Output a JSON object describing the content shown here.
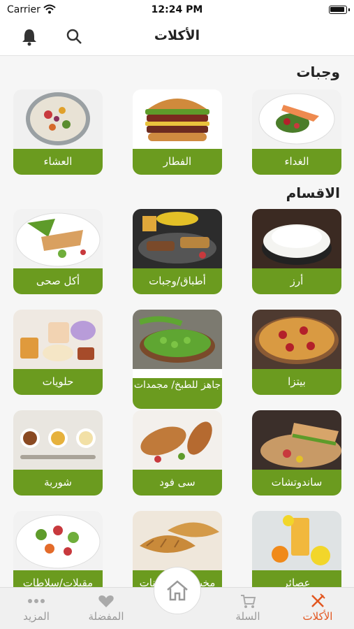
{
  "status": {
    "carrier": "Carrier",
    "time": "12:24 PM"
  },
  "header": {
    "title": "الأكلات"
  },
  "sections": {
    "meals_title": "وجبات",
    "categories_title": "الاقسام"
  },
  "meals": [
    {
      "label": "الغداء",
      "icon": "salmon-plate-image"
    },
    {
      "label": "الفطار",
      "icon": "burger-image"
    },
    {
      "label": "العشاء",
      "icon": "dinner-salad-image"
    }
  ],
  "categories": [
    {
      "label": "أرز",
      "icon": "rice-bowl-image"
    },
    {
      "label": "أطباق/وجبات",
      "icon": "grill-platter-image"
    },
    {
      "label": "أكل صحى",
      "icon": "healthy-salad-image"
    },
    {
      "label": "بيتزا",
      "icon": "pizza-image"
    },
    {
      "label": "جاهز للطبخ/ مجمدات",
      "icon": "peas-image"
    },
    {
      "label": "حلويات",
      "icon": "desserts-image"
    },
    {
      "label": "ساندوتشات",
      "icon": "sandwich-image"
    },
    {
      "label": "سى فود",
      "icon": "fish-image"
    },
    {
      "label": "شوربة",
      "icon": "soups-image"
    },
    {
      "label": "عصائر",
      "icon": "juice-image"
    },
    {
      "label": "مخبوزات/معجنات",
      "icon": "croissant-image"
    },
    {
      "label": "مقبلات/سلاطات",
      "icon": "salad-bowl-image"
    }
  ],
  "tabbar": {
    "food": "الأكلات",
    "cart": "السلة",
    "favorites": "المفضلة",
    "more": "المزيد"
  },
  "colors": {
    "accent": "#6b9b1f",
    "active_tab": "#e2561f"
  }
}
